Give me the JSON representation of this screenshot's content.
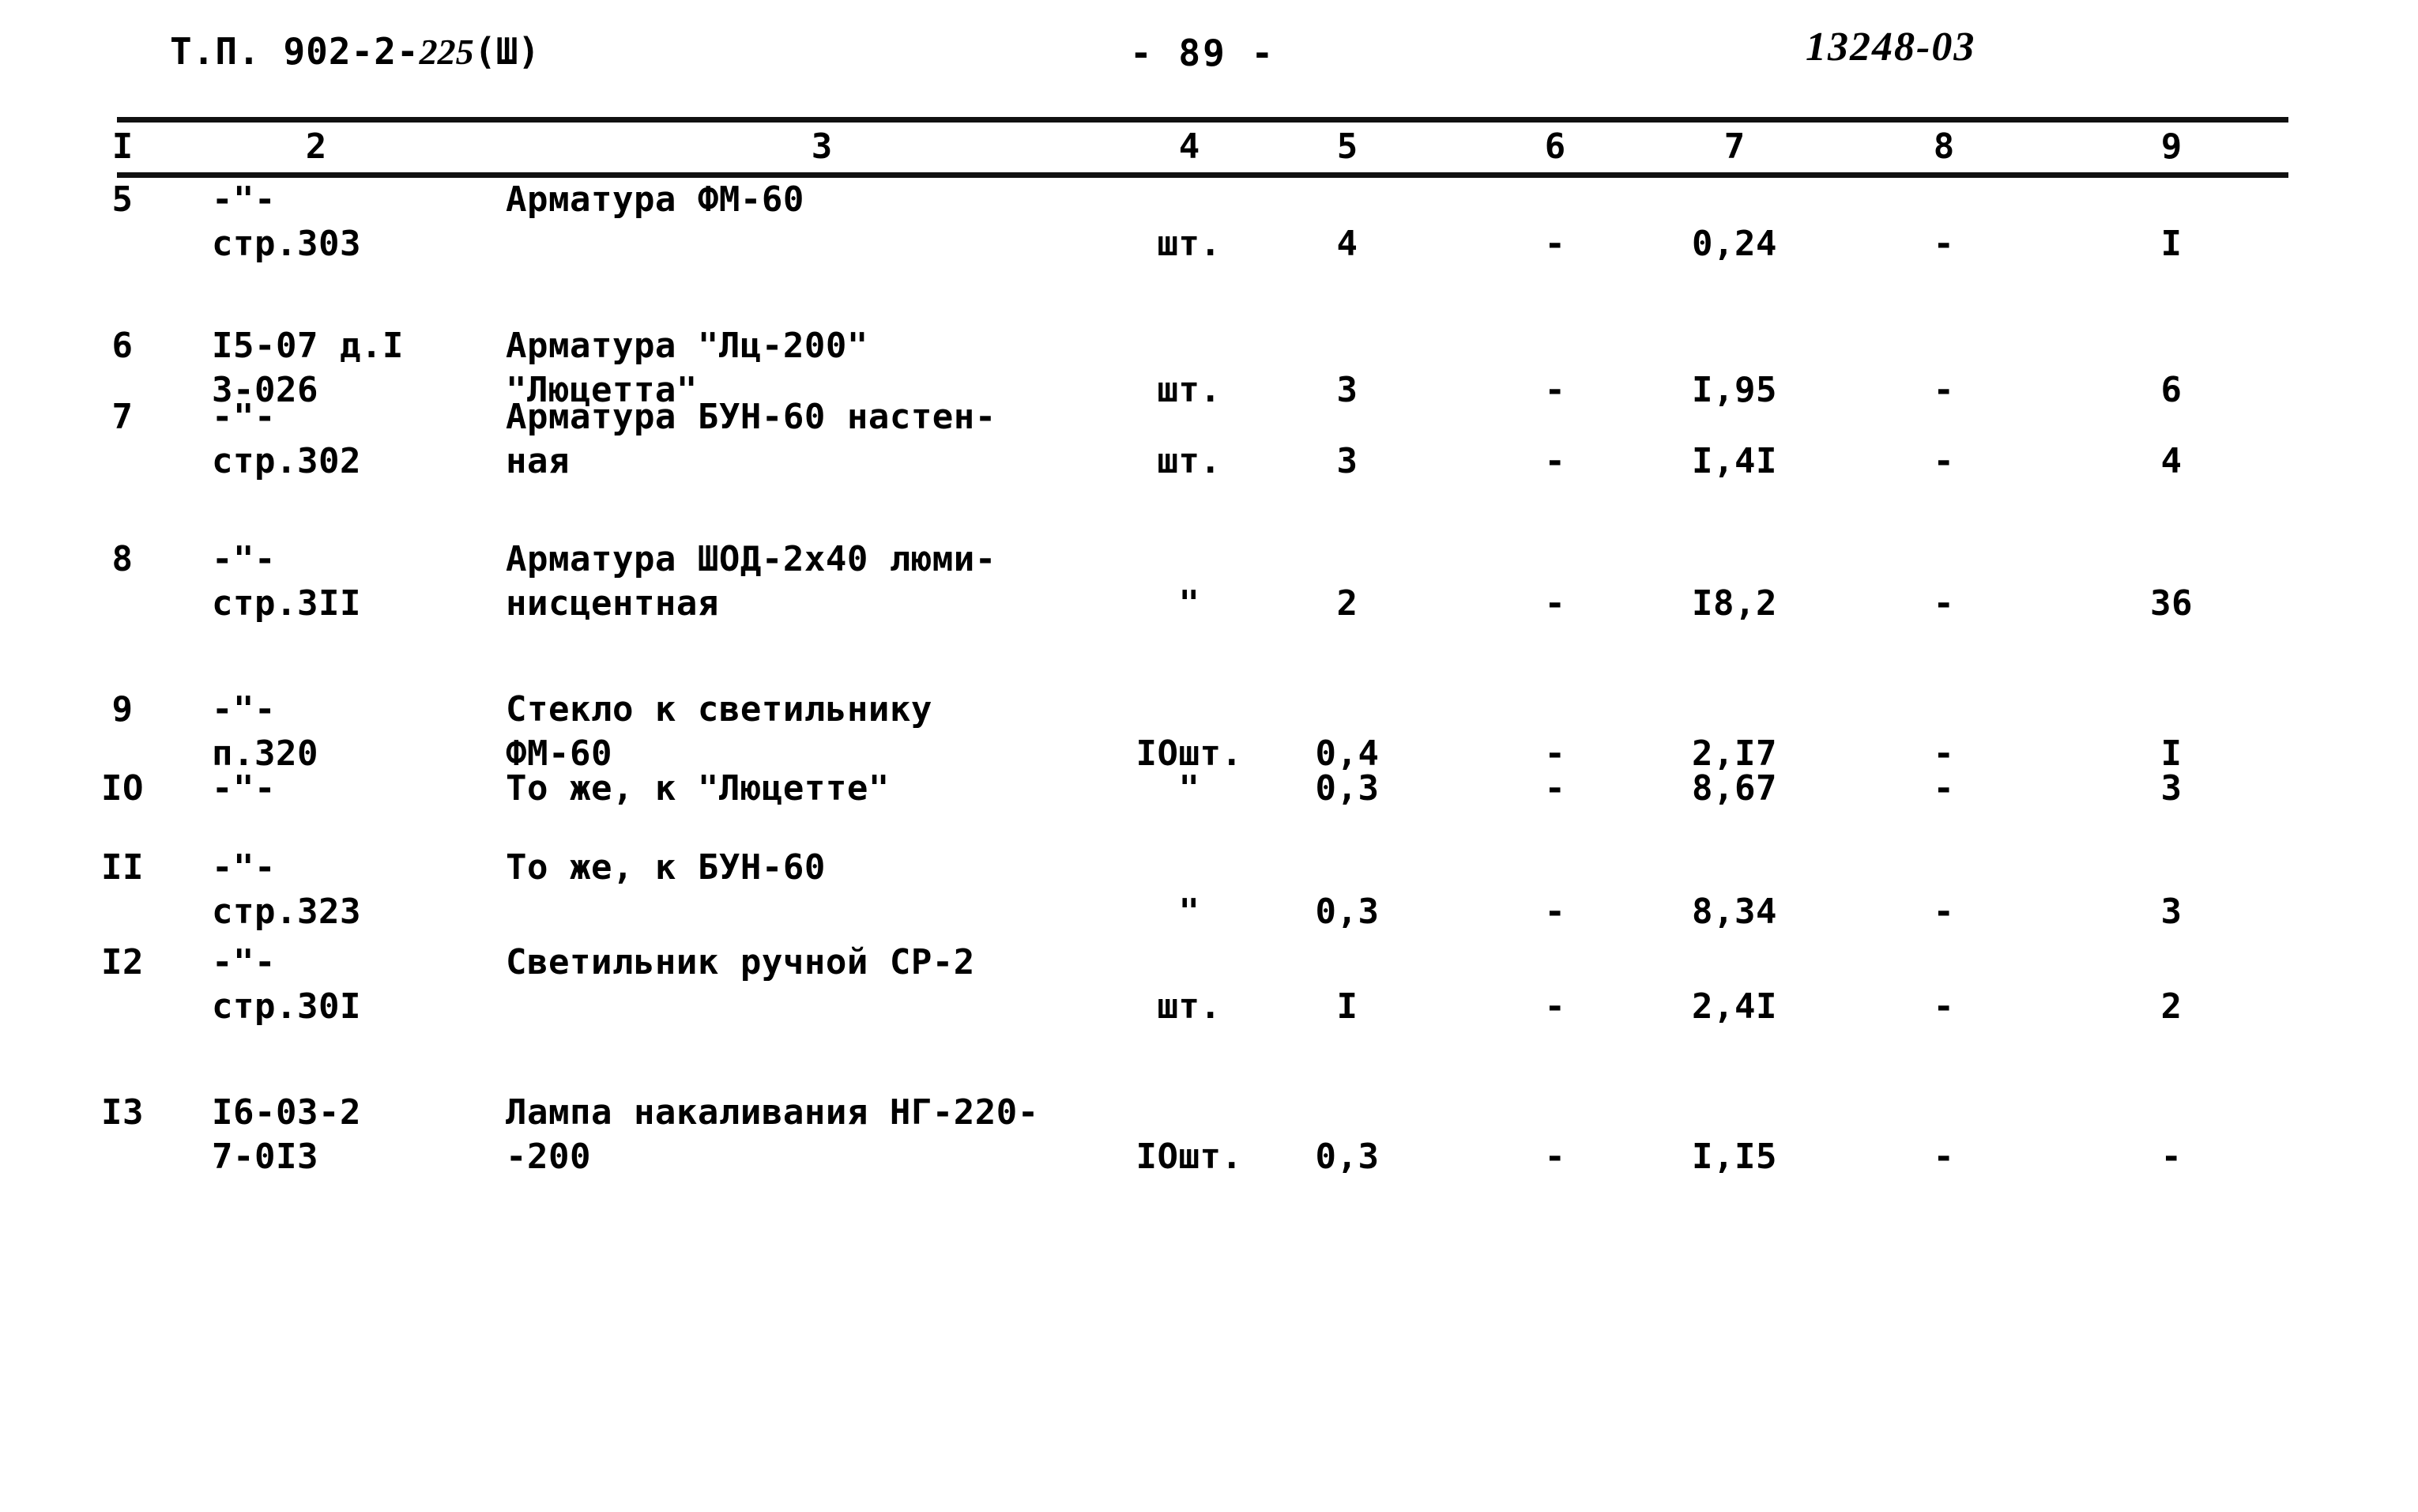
{
  "header": {
    "doc_prefix": "Т.П. 902-2-",
    "doc_number": "225",
    "section": "(Ш)",
    "page_number": "- 89 -",
    "stamp": "13248-03"
  },
  "table": {
    "column_numbers": [
      "I",
      "2",
      "3",
      "4",
      "5",
      "6",
      "7",
      "8",
      "9"
    ],
    "column_x": [
      155,
      400,
      1040,
      1505,
      1705,
      1968,
      2195,
      2460,
      2748
    ],
    "rows": [
      {
        "no": "5",
        "ref_line1": "-\"-",
        "ref_line2": "стр.303",
        "name_line1": "Арматура ФМ-60",
        "name_line2": "",
        "unit": "шт.",
        "qty": "4",
        "col6": "-",
        "col7": "0,24",
        "col8": "-",
        "col9": "I"
      },
      {
        "no": "6",
        "ref_line1": "I5-07 д.I",
        "ref_line2": "3-026",
        "name_line1": "Арматура \"Лц-200\"",
        "name_line2": "\"Люцетта\"",
        "unit": "шт.",
        "qty": "3",
        "col6": "-",
        "col7": "I,95",
        "col8": "-",
        "col9": "6"
      },
      {
        "no": "7",
        "ref_line1": "-\"-",
        "ref_line2": "стр.302",
        "name_line1": "Арматура БУН-60 настен-",
        "name_line2": "ная",
        "unit": "шт.",
        "qty": "3",
        "col6": "-",
        "col7": "I,4I",
        "col8": "-",
        "col9": "4"
      },
      {
        "no": "8",
        "ref_line1": "-\"-",
        "ref_line2": "стр.3II",
        "name_line1": "Арматура ШОД-2х40 люми-",
        "name_line2": "нисцентная",
        "unit": "\"",
        "qty": "2",
        "col6": "-",
        "col7": "I8,2",
        "col8": "-",
        "col9": "36"
      },
      {
        "no": "9",
        "ref_line1": "-\"-",
        "ref_line2": "п.320",
        "name_line1": "Стекло к светильнику",
        "name_line2": "ФМ-60",
        "unit": "IОшт.",
        "qty": "0,4",
        "col6": "-",
        "col7": "2,I7",
        "col8": "-",
        "col9": "I"
      },
      {
        "no": "IО",
        "ref_line1": "-\"-",
        "ref_line2": "",
        "name_line1": "То же, к \"Люцетте\"",
        "name_line2": "",
        "unit": "\"",
        "qty": "0,3",
        "col6": "-",
        "col7": "8,67",
        "col8": "-",
        "col9": "3"
      },
      {
        "no": "II",
        "ref_line1": "-\"-",
        "ref_line2": "стр.323",
        "name_line1": "То же, к БУН-60",
        "name_line2": "",
        "unit": "\"",
        "qty": "0,3",
        "col6": "-",
        "col7": "8,34",
        "col8": "-",
        "col9": "3"
      },
      {
        "no": "I2",
        "ref_line1": "-\"-",
        "ref_line2": "стр.30I",
        "name_line1": "Светильник ручной СР-2",
        "name_line2": "",
        "unit": "шт.",
        "qty": "I",
        "col6": "-",
        "col7": "2,4I",
        "col8": "-",
        "col9": "2"
      },
      {
        "no": "I3",
        "ref_line1": "I6-03-2",
        "ref_line2": "7-0I3",
        "name_line1": "Лампа накаливания НГ-220-",
        "name_line2": "-200",
        "unit": "IОшт.",
        "qty": "0,3",
        "col6": "-",
        "col7": "I,I5",
        "col8": "-",
        "col9": "-"
      }
    ]
  }
}
